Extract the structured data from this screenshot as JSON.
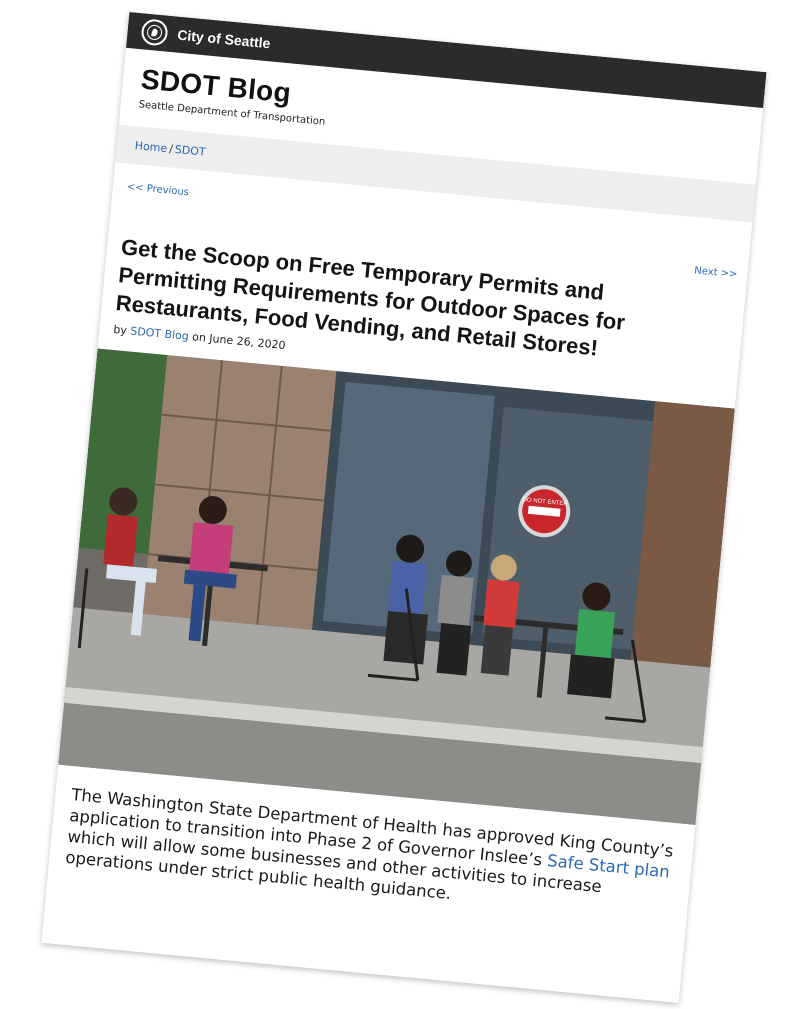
{
  "topbar": {
    "city_name": "City of Seattle",
    "seal_icon": "city-seal-icon"
  },
  "blog": {
    "title": "SDOT Blog",
    "subtitle": "Seattle Department of Transportation"
  },
  "breadcrumb": {
    "home": "Home",
    "separator": "/",
    "section": "SDOT"
  },
  "post_nav": {
    "previous": "<< Previous",
    "next": "Next >>"
  },
  "post": {
    "title": "Get the Scoop on Free Temporary Permits and Permitting Requirements for Outdoor Spaces for Restaurants, Food Vending, and Retail Stores!",
    "byline_prefix": "by",
    "author": "SDOT Blog",
    "date_prefix": "on",
    "date": "June 26, 2020",
    "sign_text": "DO NOT ENTER",
    "lead_part1": "The Washington State Department of Health has approved King County’s application to transition into Phase 2 of Governor Inslee’s",
    "lead_link": "Safe Start plan",
    "lead_part2": "which will allow some businesses and other activities to increase operations under strict public health guidance."
  },
  "colors": {
    "topbar": "#2b2b2e",
    "link": "#2a6ab3",
    "breadcrumb_bg": "#eeeeee"
  }
}
